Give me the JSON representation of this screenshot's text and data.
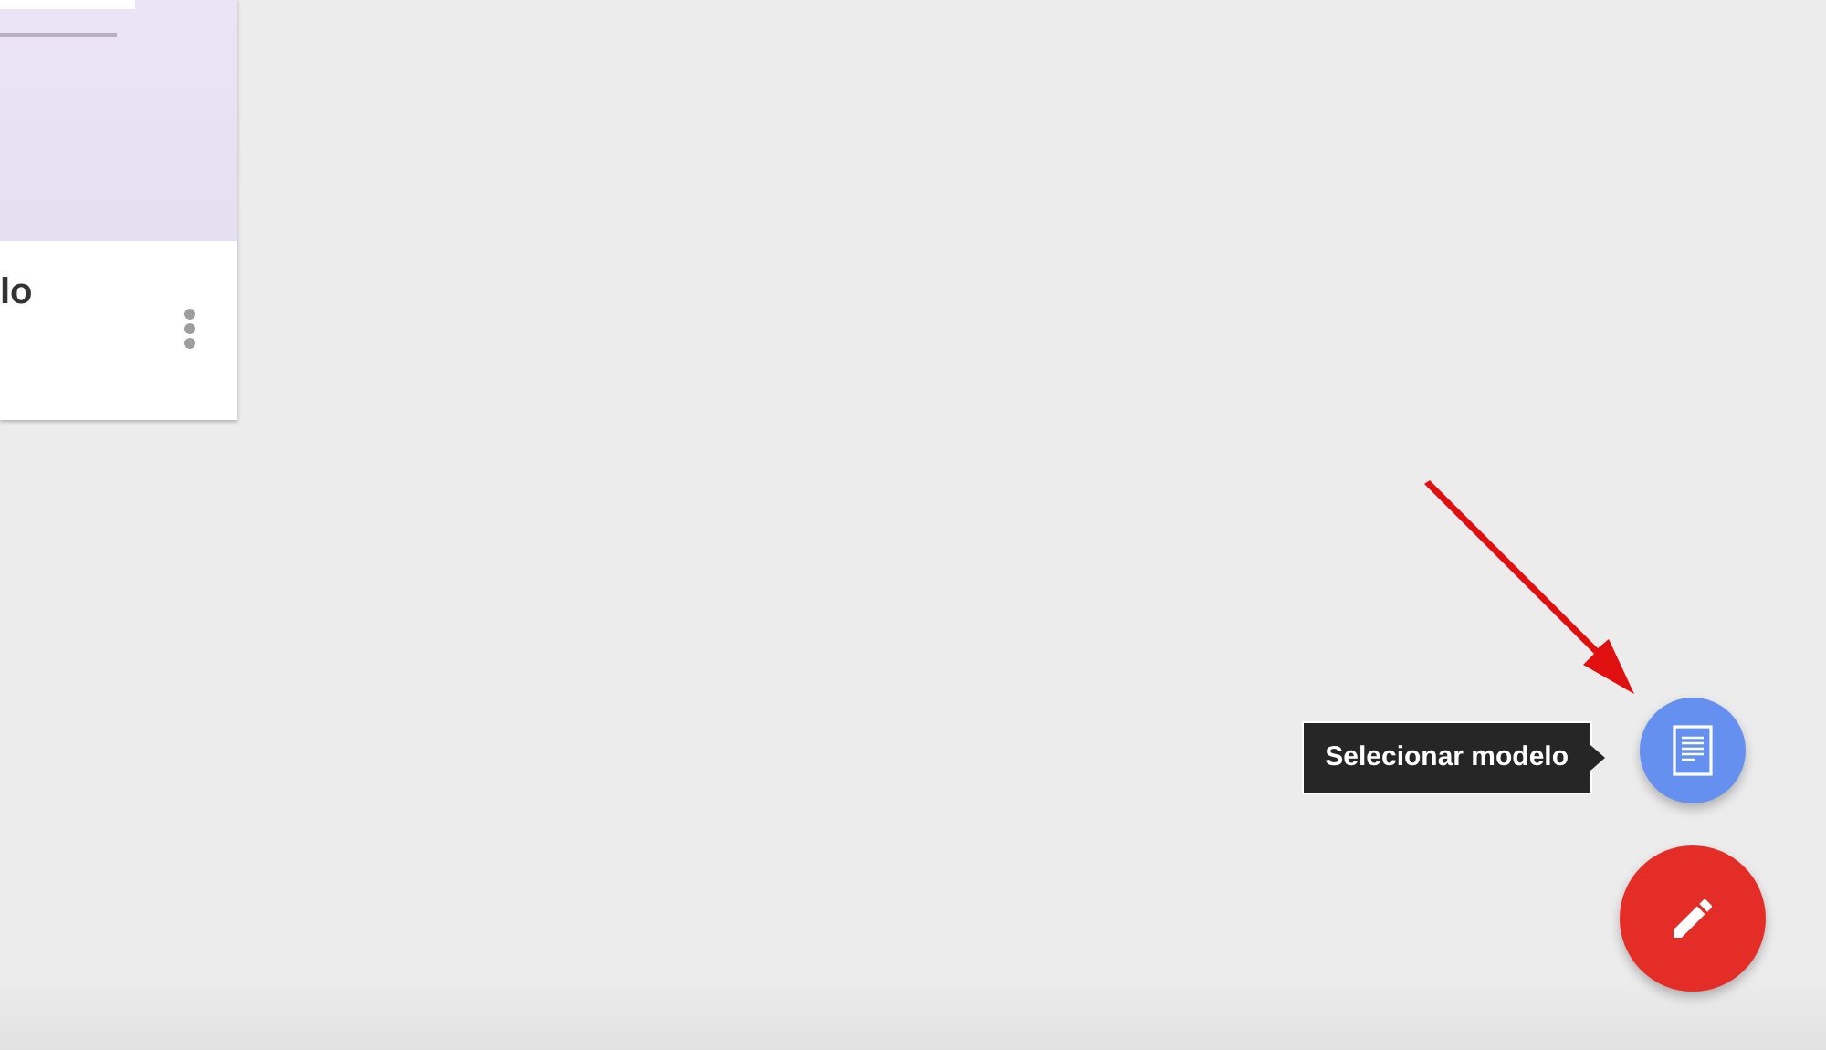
{
  "card": {
    "title": "lo"
  },
  "fab_menu": {
    "tooltip": "Selecionar modelo"
  }
}
